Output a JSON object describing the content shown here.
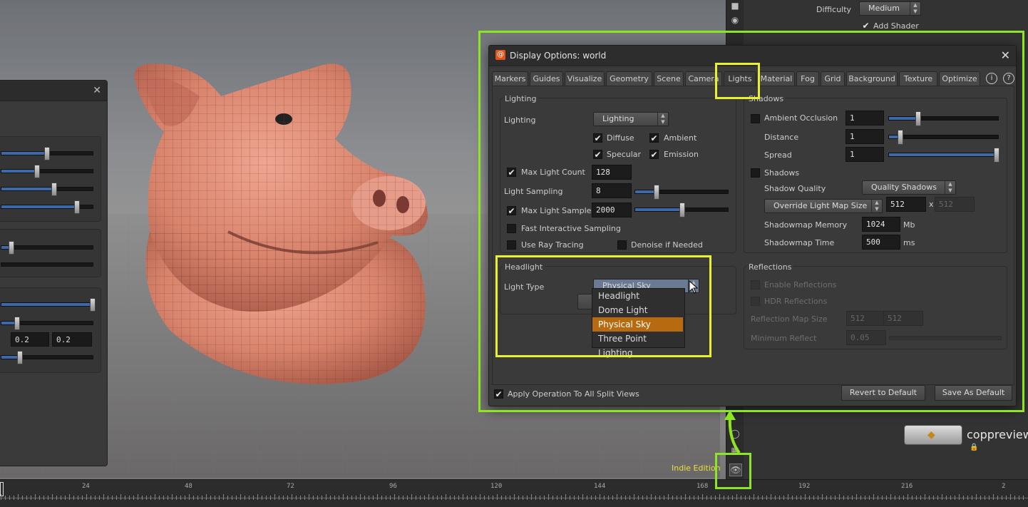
{
  "dialog": {
    "title": "Display Options:  world",
    "tabs": [
      "Markers",
      "Guides",
      "Visualize",
      "Geometry",
      "Scene",
      "Camera",
      "Lights",
      "Material",
      "Fog",
      "Grid",
      "Background",
      "Texture",
      "Optimize"
    ],
    "active_tab": "Lights",
    "lighting": {
      "section_title": "Lighting",
      "lighting_label": "Lighting",
      "lighting_value": "Lighting",
      "diffuse": "Diffuse",
      "ambient": "Ambient",
      "specular": "Specular",
      "emission": "Emission",
      "max_light_count_label": "Max Light Count",
      "max_light_count": "128",
      "light_sampling_label": "Light Sampling",
      "light_sampling": "8",
      "light_sampling_level": 0.21,
      "max_light_samples_label": "Max Light Samples",
      "max_light_samples": "2000",
      "max_light_samples_level": 0.5,
      "fast_interactive_sampling": "Fast Interactive Sampling",
      "use_ray_tracing": "Use Ray Tracing",
      "denoise_if_needed": "Denoise if Needed"
    },
    "shadows": {
      "section_title": "Shadows",
      "ambient_occlusion": "Ambient Occlusion",
      "ambient_occlusion_value": "1",
      "ambient_occlusion_level": 0.25,
      "distance_label": "Distance",
      "distance_value": "1",
      "distance_level": 0.08,
      "spread_label": "Spread",
      "spread_value": "1",
      "spread_level": 1.0,
      "shadows_label": "Shadows",
      "shadow_quality_label": "Shadow Quality",
      "shadow_quality_value": "Quality Shadows",
      "override_light_map_size": "Override Light Map Size",
      "map_size_x": "512",
      "map_size_sep": "x",
      "map_size_y": "512",
      "shadowmap_memory_label": "Shadowmap Memory",
      "shadowmap_memory": "1024",
      "shadowmap_memory_unit": "Mb",
      "shadowmap_time_label": "Shadowmap Time",
      "shadowmap_time": "500",
      "shadowmap_time_unit": "ms"
    },
    "headlight": {
      "section_title": "Headlight",
      "light_type_label": "Light Type",
      "light_type_value": "Physical Sky",
      "options": [
        "Headlight",
        "Dome Light",
        "Physical Sky",
        "Three Point Lighting"
      ],
      "selected_option": "Physical Sky"
    },
    "reflections": {
      "section_title": "Reflections",
      "enable_reflections": "Enable Reflections",
      "hdr_reflections": "HDR Reflections",
      "reflection_map_size_label": "Reflection Map Size",
      "map_x": "512",
      "map_sep": "x",
      "map_y": "512",
      "minimum_reflect_label": "Minimum Reflect",
      "minimum_reflect": "0.05"
    },
    "apply_all_split_views": "Apply Operation To All Split Views",
    "revert_button": "Revert to Default",
    "save_button": "Save As Default"
  },
  "right_panel": {
    "difficulty_label": "Difficulty",
    "difficulty_value": "Medium",
    "add_shader": "Add Shader",
    "node_name": "coppreview"
  },
  "left_panel": {
    "value_a": "0.2",
    "value_b": "0.2"
  },
  "edition_label": "Indie Edition",
  "timeline": {
    "frames": [
      "24",
      "48",
      "72",
      "96",
      "120",
      "144",
      "168",
      "192",
      "216",
      "2"
    ]
  },
  "colors": {
    "accent_selection": "#b76a0f",
    "highlight_yellow": "#e8f22c",
    "highlight_green": "#8ee522",
    "slider_fill": "#3c6aa8"
  }
}
